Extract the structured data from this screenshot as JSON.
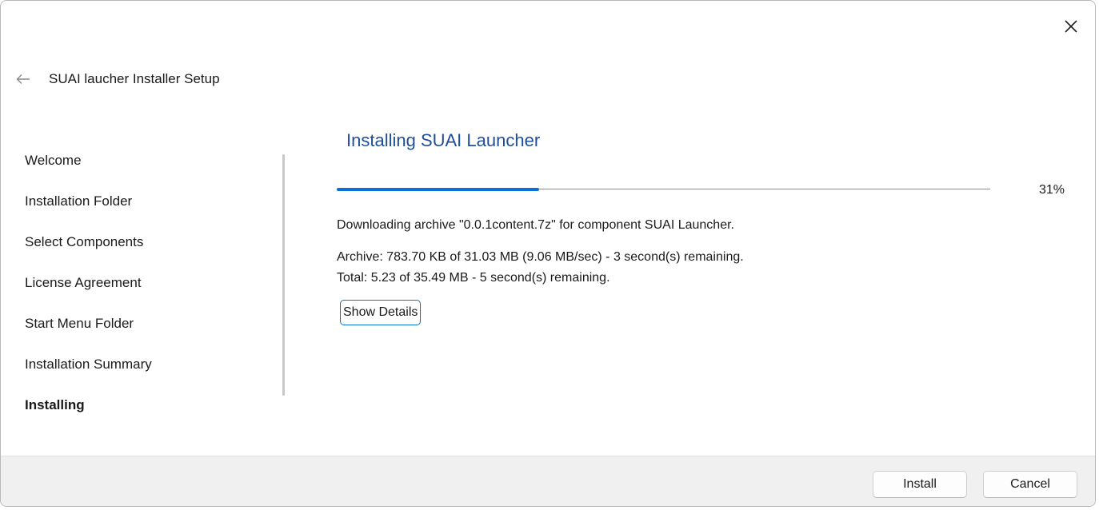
{
  "window": {
    "title": "SUAI laucher Installer Setup"
  },
  "icons": {
    "back": "back-arrow-icon",
    "close": "close-icon"
  },
  "sidebar": {
    "items": [
      {
        "label": "Welcome",
        "active": false
      },
      {
        "label": "Installation Folder",
        "active": false
      },
      {
        "label": "Select Components",
        "active": false
      },
      {
        "label": "License Agreement",
        "active": false
      },
      {
        "label": "Start Menu Folder",
        "active": false
      },
      {
        "label": "Installation Summary",
        "active": false
      },
      {
        "label": "Installing",
        "active": true
      }
    ]
  },
  "main": {
    "heading": "Installing SUAI Launcher",
    "progress": {
      "fraction": 0.31,
      "label": "31%"
    },
    "status": "Downloading archive \"0.0.1content.7z\" for component SUAI Launcher.",
    "archive_line": "Archive: 783.70 KB of 31.03 MB (9.06 MB/sec) - 3 second(s) remaining.",
    "total_line": "Total: 5.23 of 35.49 MB - 5 second(s) remaining.",
    "details_button": "Show Details"
  },
  "footer": {
    "install_label": "Install",
    "cancel_label": "Cancel"
  },
  "colors": {
    "accent": "#0a6fd6",
    "heading": "#1f4e9c",
    "footer_bg": "#f0f0f0"
  }
}
